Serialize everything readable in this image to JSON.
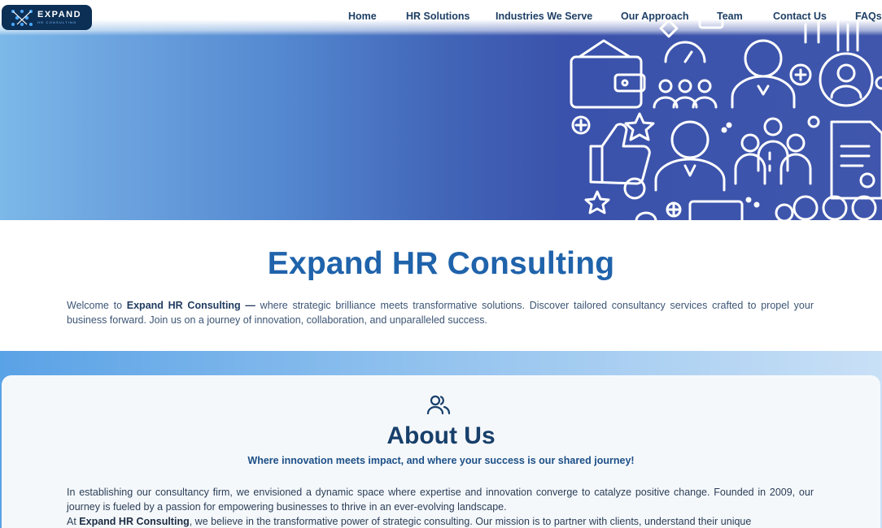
{
  "brand": {
    "name": "EXPAND",
    "tagline": "HR CONSULTING"
  },
  "nav": {
    "items": [
      {
        "label": "Home"
      },
      {
        "label": "HR Solutions"
      },
      {
        "label": "Industries We Serve"
      },
      {
        "label": "Our Approach"
      },
      {
        "label": "Team"
      },
      {
        "label": "Contact Us"
      },
      {
        "label": "FAQs"
      }
    ]
  },
  "hero": {
    "illustration": "hr-icons-illustration"
  },
  "intro": {
    "title": "Expand HR Consulting",
    "lead": "Welcome to ",
    "brand": "Expand HR Consulting —",
    "text": " where strategic brilliance meets transformative solutions. Discover tailored consultancy services crafted to propel your business forward. Join us on a journey of innovation, collaboration, and unparalleled success."
  },
  "about": {
    "icon": "users-icon",
    "title": "About Us",
    "subtitle": "Where innovation meets impact, and where your success is our shared journey!",
    "paragraph1": "In establishing our consultancy firm, we envisioned a dynamic space where expertise and innovation converge to catalyze positive change. Founded in 2009, our journey is fueled by a passion for empowering businesses to thrive in an ever-evolving landscape.",
    "p2_lead": "At ",
    "p2_brand": "Expand HR Consulting",
    "p2_text": ", we believe in the transformative power of strategic consulting. Our mission is to partner with clients, understand their unique"
  },
  "colors": {
    "brand_dark": "#0c2f55",
    "title_blue": "#1f63ab",
    "hero_light": "#7cb8e8",
    "hero_dark": "#3a52ab"
  }
}
